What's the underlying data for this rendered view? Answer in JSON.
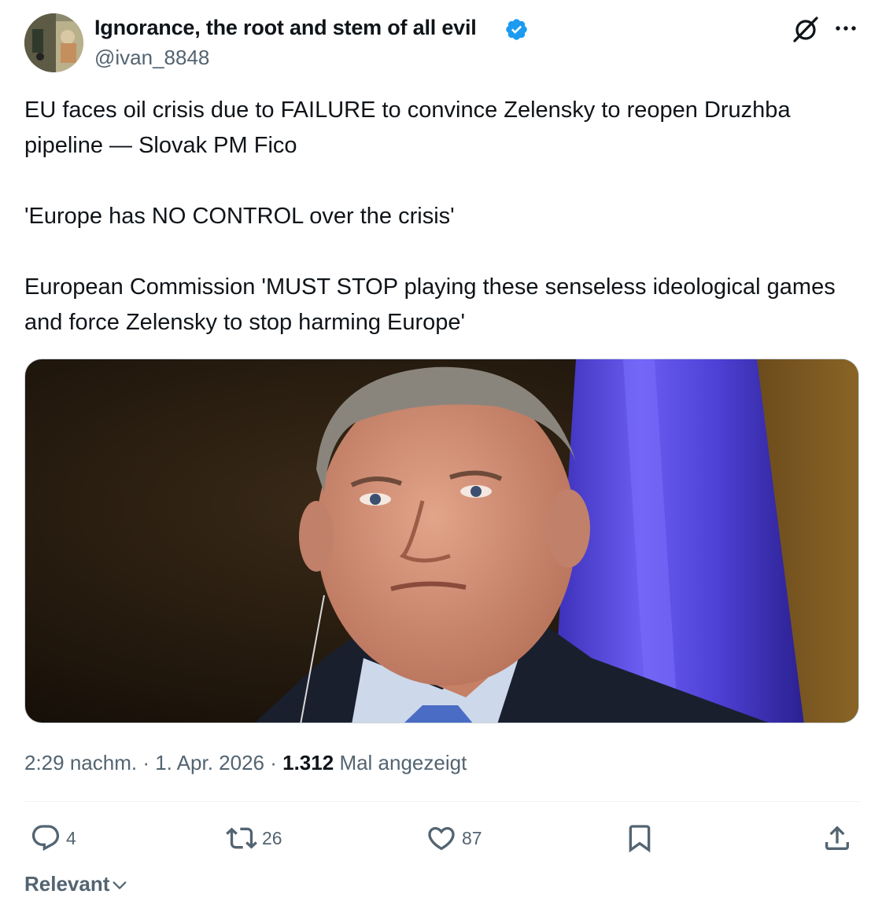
{
  "author": {
    "display_name": "Ignorance, the root and stem of all evil",
    "handle": "@ivan_8848",
    "verified": true
  },
  "tweet": {
    "paragraphs": [
      "EU faces oil crisis due to FAILURE to convince Zelensky to reopen Druzhba pipeline — Slovak PM Fico",
      "'Europe has NO CONTROL over the crisis'",
      "European Commission 'MUST STOP playing these senseless ideological games and force Zelensky to stop harming Europe'"
    ]
  },
  "meta": {
    "time": "2:29 nachm.",
    "date": "1. Apr. 2026",
    "views_count": "1.312",
    "views_label": "Mal angezeigt"
  },
  "actions": {
    "reply_count": "4",
    "repost_count": "26",
    "like_count": "87"
  },
  "sort": {
    "label": "Relevant"
  },
  "colors": {
    "text": "#0f1419",
    "secondary": "#536471",
    "verified": "#1d9bf0",
    "flag_blue": "#5b4fe0"
  },
  "icons": [
    "verified-badge-icon",
    "grok-icon",
    "more-icon",
    "reply-icon",
    "repost-icon",
    "like-icon",
    "bookmark-icon",
    "share-icon",
    "chevron-down-icon"
  ]
}
